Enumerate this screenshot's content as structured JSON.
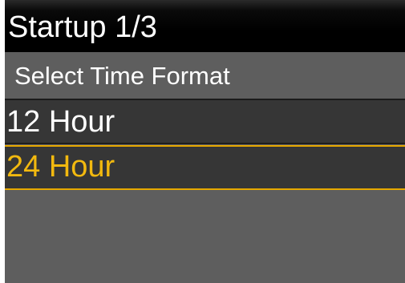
{
  "header": {
    "title": "Startup 1/3"
  },
  "prompt": {
    "label": "Select Time Format"
  },
  "options": [
    {
      "label": "12 Hour",
      "selected": false
    },
    {
      "label": "24 Hour",
      "selected": true
    }
  ],
  "colors": {
    "title_background": "#000000",
    "screen_background": "#5e5e5e",
    "option_background": "#363636",
    "selected_text": "#f2b90f",
    "selected_border": "#e6a800",
    "text": "#ffffff"
  }
}
